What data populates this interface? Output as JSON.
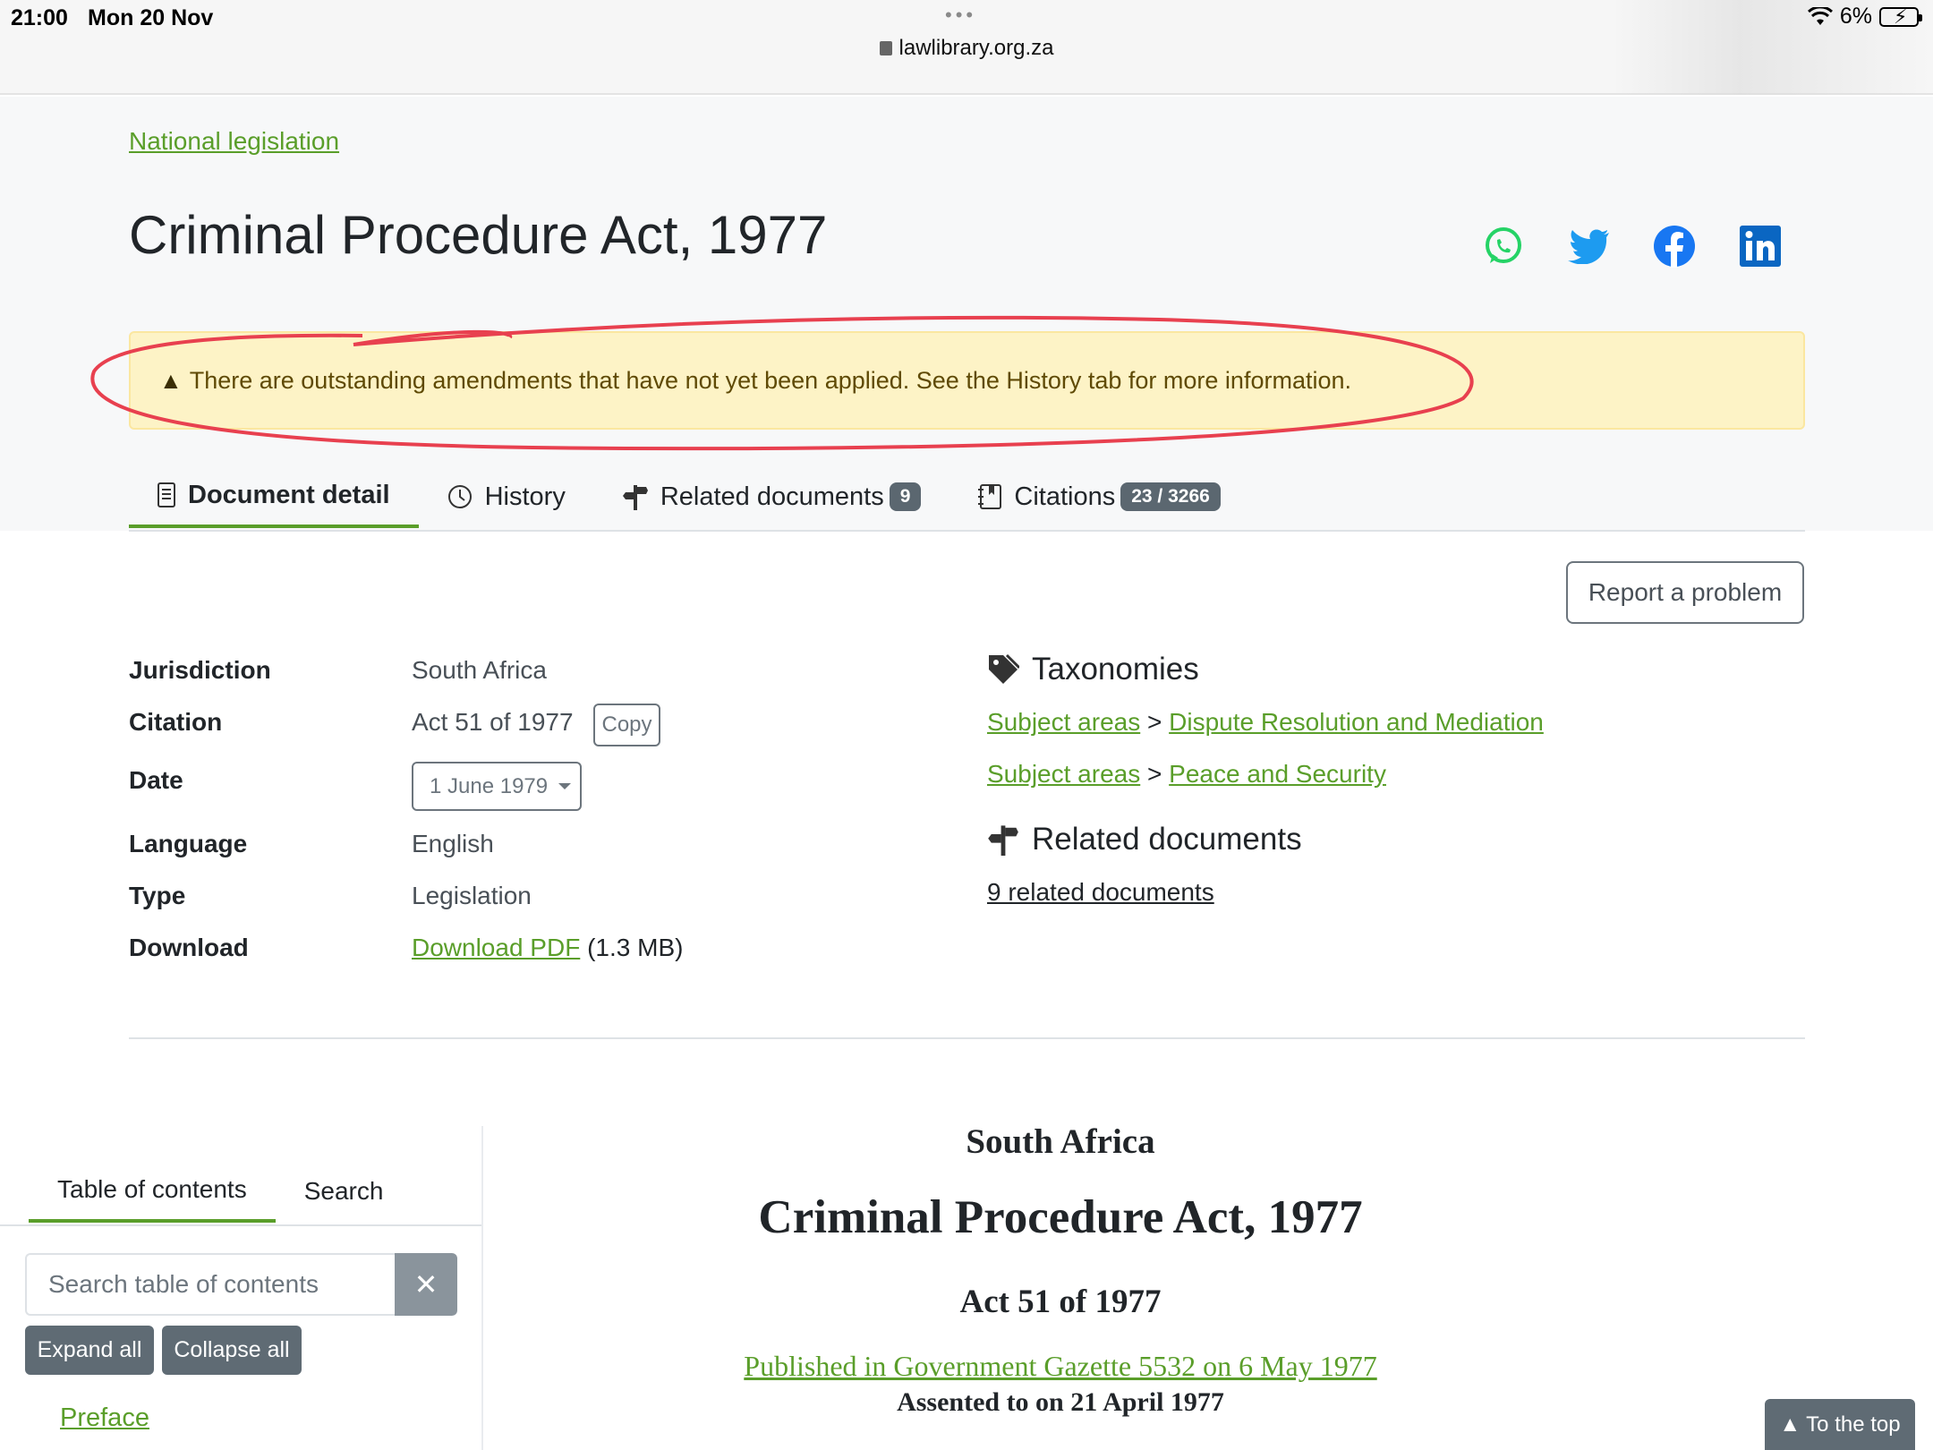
{
  "status_bar": {
    "time": "21:00",
    "date": "Mon 20 Nov",
    "url": "lawlibrary.org.za",
    "battery": "6%"
  },
  "page": {
    "breadcrumb": "National legislation",
    "title": "Criminal Procedure Act, 1977",
    "share_icons": [
      "whatsapp-icon",
      "twitter-icon",
      "facebook-icon",
      "linkedin-icon"
    ],
    "alert": "There are outstanding amendments that have not yet been applied. See the History tab for more information."
  },
  "tabs": [
    {
      "label": "Document detail",
      "icon": "document-icon",
      "active": true
    },
    {
      "label": "History",
      "icon": "clock-icon"
    },
    {
      "label": "Related documents",
      "icon": "signpost-icon",
      "badge": "9"
    },
    {
      "label": "Citations",
      "icon": "journal-icon",
      "badge": "23 / 3266"
    }
  ],
  "report_button": "Report a problem",
  "meta": {
    "jurisdiction_label": "Jurisdiction",
    "jurisdiction_value": "South Africa",
    "citation_label": "Citation",
    "citation_value": "Act 51 of 1977",
    "copy_label": "Copy",
    "date_label": "Date",
    "date_value": "1 June 1979",
    "language_label": "Language",
    "language_value": "English",
    "type_label": "Type",
    "type_value": "Legislation",
    "download_label": "Download",
    "download_link": "Download PDF",
    "download_size": "(1.3 MB)"
  },
  "taxonomies": {
    "heading": "Taxonomies",
    "items": [
      {
        "parent": "Subject areas",
        "sep": ">",
        "child": "Dispute Resolution and Mediation"
      },
      {
        "parent": "Subject areas",
        "sep": ">",
        "child": "Peace and Security"
      }
    ]
  },
  "related": {
    "heading": "Related documents",
    "link": "9 related documents"
  },
  "toc": {
    "tab_toc": "Table of contents",
    "tab_search": "Search",
    "search_placeholder": "Search table of contents",
    "expand": "Expand all",
    "collapse": "Collapse all",
    "first_item": "Preface"
  },
  "document": {
    "country": "South Africa",
    "title": "Criminal Procedure Act, 1977",
    "number": "Act 51 of 1977",
    "gazette": "Published in Government Gazette 5532 on 6 May 1977",
    "assented": "Assented to on 21 April 1977"
  },
  "to_top": "To the top",
  "colors": {
    "link_green": "#5a9e2a",
    "alert_bg": "#fdf3c6",
    "annotation_red": "#e8404f",
    "badge_gray": "#5b6770"
  }
}
